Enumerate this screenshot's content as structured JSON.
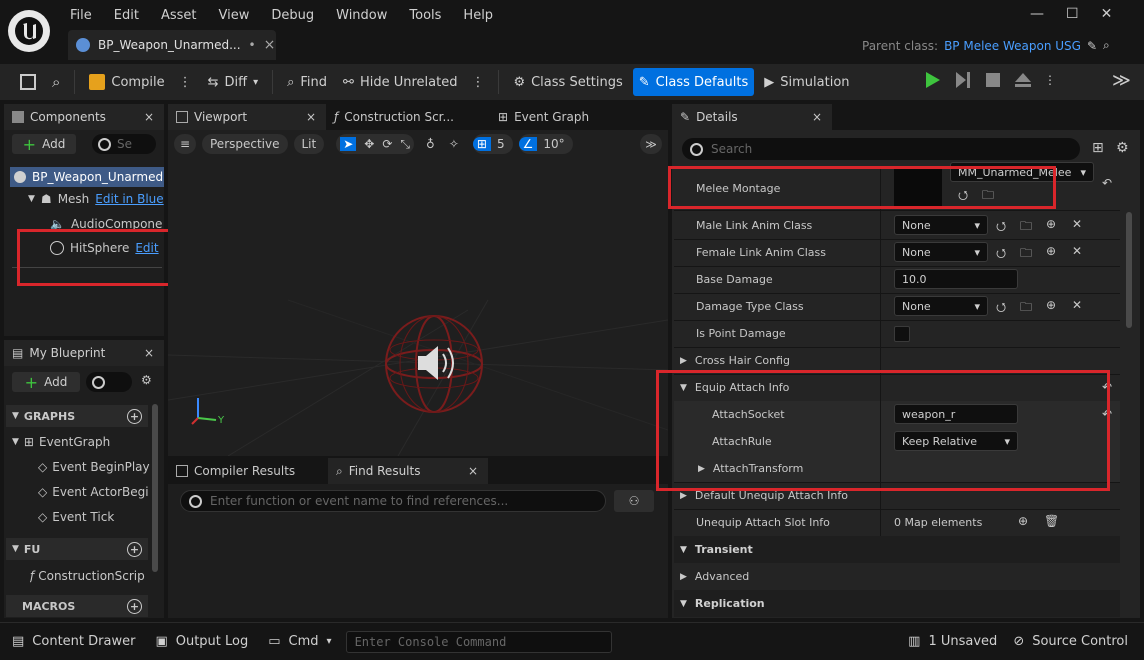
{
  "menu": [
    "File",
    "Edit",
    "Asset",
    "View",
    "Debug",
    "Window",
    "Tools",
    "Help"
  ],
  "doc_tab": {
    "title": "BP_Weapon_Unarmed...",
    "modified_mark": "•",
    "close": "×"
  },
  "parent_class": {
    "label": "Parent class:",
    "value": "BP Melee Weapon USG"
  },
  "toolbar": {
    "compile": "Compile",
    "diff": "Diff",
    "find": "Find",
    "hide_unrelated": "Hide Unrelated",
    "class_settings": "Class Settings",
    "class_defaults": "Class Defaults",
    "simulation": "Simulation"
  },
  "components": {
    "title": "Components",
    "add": "Add",
    "search_placeholder": "Se",
    "tree": {
      "root": "BP_Weapon_Unarmed",
      "mesh": "Mesh",
      "mesh_link": "Edit in Blue",
      "audio": "AudioCompone",
      "hitsphere": "HitSphere",
      "hitsphere_link": "Edit"
    }
  },
  "viewport_tabs": {
    "viewport": "Viewport",
    "construction": "Construction Scr...",
    "event_graph": "Event Graph"
  },
  "viewport_toolbar": {
    "perspective": "Perspective",
    "lit": "Lit",
    "grid_snap": "5",
    "rot_snap": "10°"
  },
  "my_blueprint": {
    "title": "My Blueprint",
    "add": "Add",
    "graphs_header": "GRAPHS",
    "event_graph": "EventGraph",
    "events": [
      "Event BeginPlay",
      "Event ActorBegi",
      "Event Tick"
    ],
    "functions_header": "FU",
    "construction_script": "ConstructionScrip",
    "macros_header": "MACROS"
  },
  "results_tabs": {
    "compiler": "Compiler Results",
    "find": "Find Results",
    "find_placeholder": "Enter function or event name to find references..."
  },
  "details": {
    "title": "Details",
    "search_placeholder": "Search",
    "melee_montage": {
      "label": "Melee Montage",
      "asset": "MM_Unarmed_Melee"
    },
    "male_link": {
      "label": "Male Link Anim Class",
      "value": "None"
    },
    "female_link": {
      "label": "Female Link Anim Class",
      "value": "None"
    },
    "base_damage": {
      "label": "Base Damage",
      "value": "10.0"
    },
    "damage_type": {
      "label": "Damage Type Class",
      "value": "None"
    },
    "is_point_damage": {
      "label": "Is Point Damage",
      "checked": false
    },
    "cross_hair": "Cross Hair Config",
    "equip_attach": "Equip Attach Info",
    "attach_socket": {
      "label": "AttachSocket",
      "value": "weapon_r"
    },
    "attach_rule": {
      "label": "AttachRule",
      "value": "Keep Relative"
    },
    "attach_transform": "AttachTransform",
    "default_unequip": "Default Unequip Attach Info",
    "unequip_slot": {
      "label": "Unequip Attach Slot Info",
      "value": "0 Map elements"
    },
    "categories": {
      "transient": "Transient",
      "advanced": "Advanced",
      "replication": "Replication"
    }
  },
  "bottom_bar": {
    "content_drawer": "Content Drawer",
    "output_log": "Output Log",
    "cmd": "Cmd",
    "console_placeholder": "Enter Console Command",
    "unsaved": "1 Unsaved",
    "source_control": "Source Control"
  },
  "colors": {
    "accent": "#0070e0",
    "highlight": "#d9262b",
    "link": "#4a9eff",
    "play": "#3ec43e"
  }
}
